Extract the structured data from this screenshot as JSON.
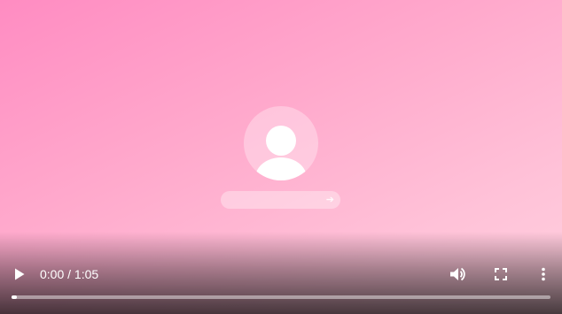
{
  "video": {
    "current_time": "0:00",
    "separator": "/",
    "duration": "1:05",
    "progress_fraction": 0.01
  },
  "controls": {
    "play_icon": "play-icon",
    "volume_icon": "volume-up-icon",
    "fullscreen_icon": "fullscreen-icon",
    "menu_icon": "more-vertical-icon"
  },
  "video_frame": {
    "login_screen": {
      "avatar_icon": "user-avatar-icon",
      "submit_icon": "arrow-right-icon",
      "arrow_glyph": "➔"
    }
  },
  "colors": {
    "gradient_start": "#ff8cc2",
    "gradient_end": "#ffd1df",
    "control_text": "#ffffff"
  }
}
